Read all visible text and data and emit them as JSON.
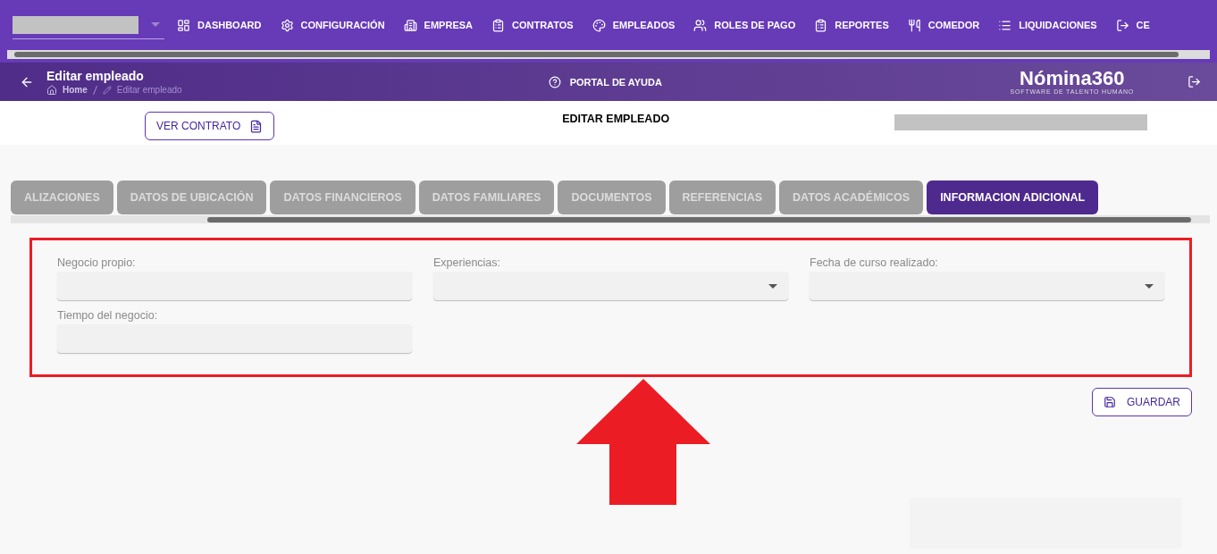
{
  "nav": {
    "items": [
      {
        "label": "DASHBOARD"
      },
      {
        "label": "CONFIGURACIÓN"
      },
      {
        "label": "EMPRESA"
      },
      {
        "label": "CONTRATOS"
      },
      {
        "label": "EMPLEADOS"
      },
      {
        "label": "ROLES DE PAGO"
      },
      {
        "label": "REPORTES"
      },
      {
        "label": "COMEDOR"
      },
      {
        "label": "LIQUIDACIONES"
      },
      {
        "label": "CE"
      }
    ]
  },
  "header": {
    "title": "Editar empleado",
    "breadcrumb": [
      "Home",
      "Editar empleado"
    ],
    "help": "PORTAL DE AYUDA",
    "logo": "Nómina360",
    "logo_tagline": "SOFTWARE DE TALENTO HUMANO"
  },
  "toolbar": {
    "button": "VER CONTRATO",
    "title": "EDITAR EMPLEADO"
  },
  "tabs": [
    {
      "label": "ALIZACIONES",
      "selected": false
    },
    {
      "label": "DATOS DE UBICACIÓN",
      "selected": false
    },
    {
      "label": "DATOS FINANCIEROS",
      "selected": false
    },
    {
      "label": "DATOS FAMILIARES",
      "selected": false
    },
    {
      "label": "DOCUMENTOS",
      "selected": false
    },
    {
      "label": "REFERENCIAS",
      "selected": false
    },
    {
      "label": "DATOS ACADÉMICOS",
      "selected": false
    },
    {
      "label": "INFORMACION ADICIONAL",
      "selected": true
    }
  ],
  "fields": [
    {
      "label": "Negocio propio:",
      "kind": "text"
    },
    {
      "label": "Experiencias:",
      "kind": "select"
    },
    {
      "label": "Fecha de curso realizado:",
      "kind": "select"
    },
    {
      "label": "Tiempo del negocio:",
      "kind": "text"
    }
  ],
  "save_button": "GUARDAR"
}
